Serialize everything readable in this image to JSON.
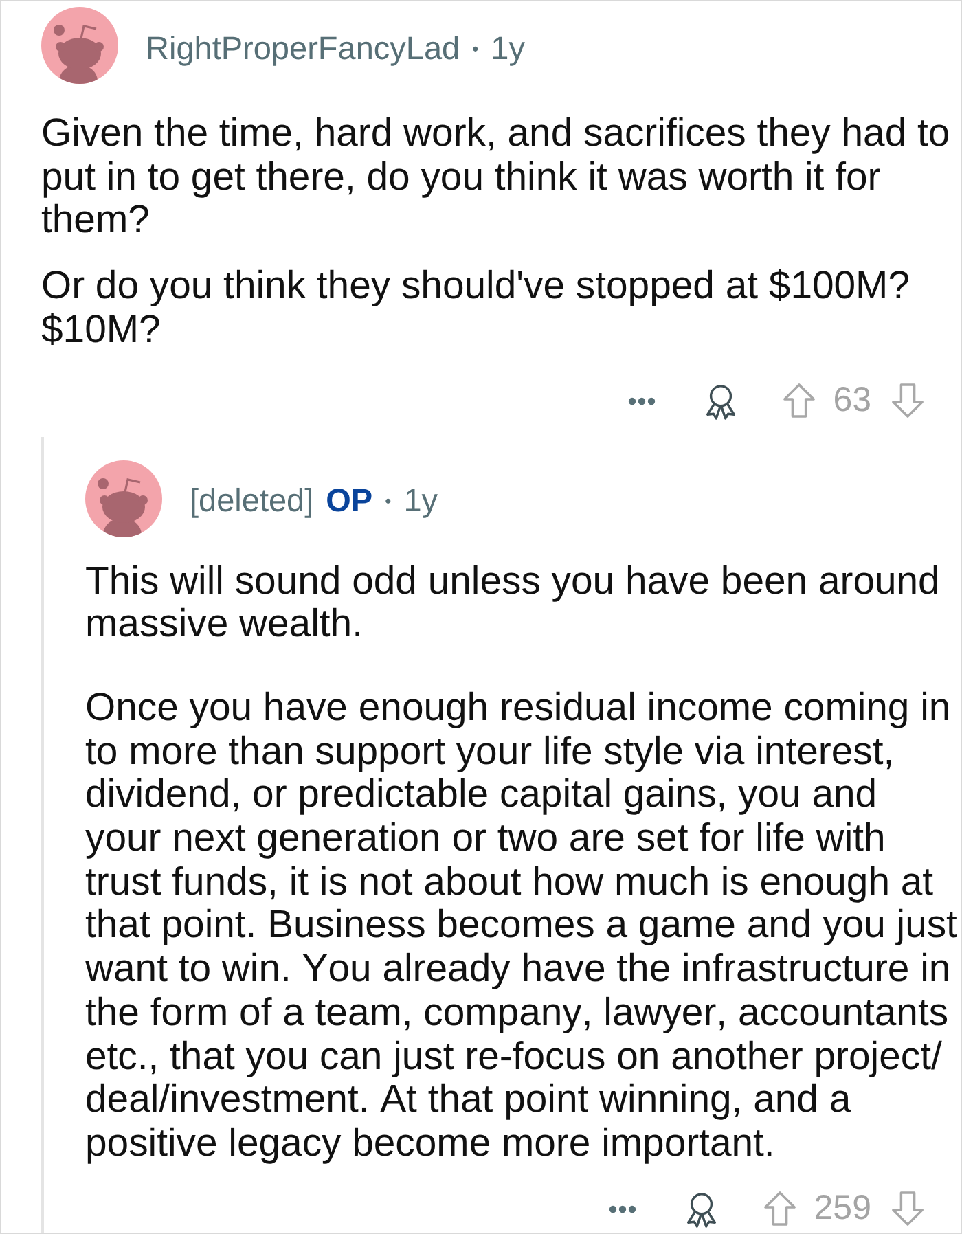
{
  "comment": {
    "author": "RightProperFancyLad",
    "separator": "•",
    "age": "1y",
    "paragraphs": [
      "Given the time, hard work, and sacrifices they had to put in to get there, do you think it was worth it for them?",
      "Or do you think they should've stopped at $100M? $10M?"
    ],
    "votes": "63",
    "replies": [
      {
        "author": "[deleted]",
        "flair": "OP",
        "separator": "•",
        "age": "1y",
        "paragraphs": [
          "This will sound odd unless you have been around massive wealth.",
          "Once you have enough residual income coming in to more than support your life style via interest, dividend, or predictable capital gains, you and your next generation or two are set for life with trust funds, it is not about how much is enough at that point. Business becomes a game and you just want to win. You already have the infrastructure in the form of a team, company, lawyer, accountants etc., that you can just re-focus on another project/ deal/investment. At that point winning, and a positive legacy become more important."
        ],
        "votes": "259"
      }
    ]
  }
}
